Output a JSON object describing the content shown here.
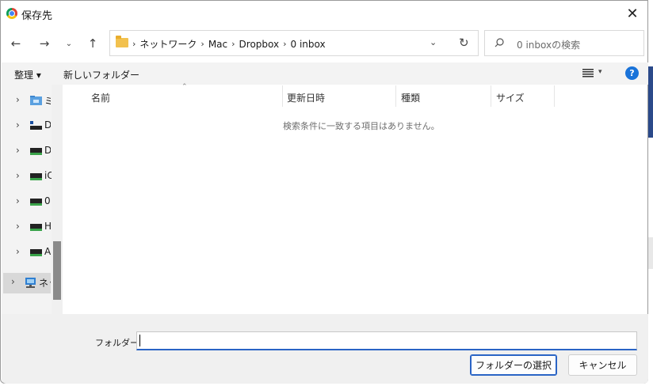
{
  "window": {
    "title": "保存先"
  },
  "address": {
    "crumbs": [
      "ネットワーク",
      "Mac",
      "Dropbox",
      "0 inbox"
    ],
    "dropdown": "⌄",
    "refresh": "↻"
  },
  "search": {
    "placeholder": "0 inboxの検索"
  },
  "toolbar": {
    "organize": "整理 ▾",
    "new_folder": "新しいフォルダー"
  },
  "nav_pane": {
    "items": [
      {
        "label": "ミ",
        "icon": "folder-blue-icon"
      },
      {
        "label": "D",
        "icon": "desktop-icon"
      },
      {
        "label": "D",
        "icon": "drive-icon"
      },
      {
        "label": "iC",
        "icon": "drive-icon"
      },
      {
        "label": "0",
        "icon": "drive-icon"
      },
      {
        "label": "H",
        "icon": "drive-icon"
      },
      {
        "label": "A",
        "icon": "drive-icon"
      },
      {
        "label": "ネッ",
        "icon": "network-icon"
      }
    ]
  },
  "columns": [
    "名前",
    "更新日時",
    "種類",
    "サイズ"
  ],
  "empty_message": "検索条件に一致する項目はありません。",
  "bottom": {
    "folder_label": "フォルダー:",
    "folder_value": "",
    "select_button": "フォルダーの選択",
    "cancel_button": "キャンセル"
  },
  "colors": {
    "accent": "#2a64c5",
    "help": "#1a73d9",
    "folder": "#f2c14e"
  }
}
